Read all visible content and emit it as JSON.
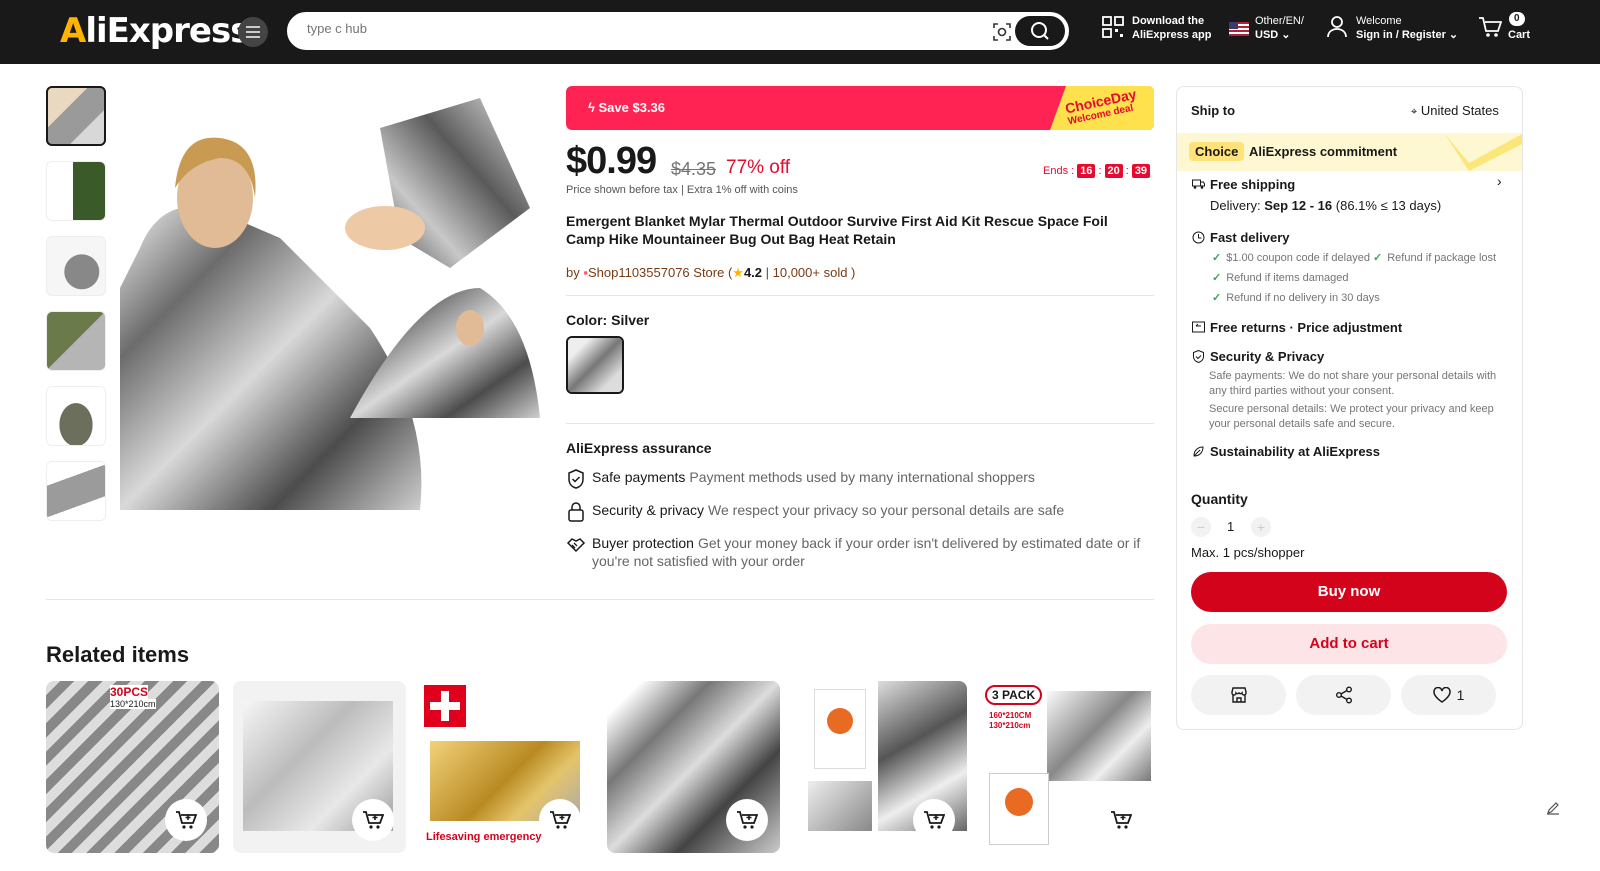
{
  "header": {
    "logo": "AliExpress",
    "search_placeholder": "type c hub",
    "download_line1": "Download the",
    "download_line2": "AliExpress app",
    "locale_line1": "Other/EN/",
    "locale_line2": "USD",
    "welcome": "Welcome",
    "signin": "Sign in / Register",
    "cart_count": "0",
    "cart_label": "Cart"
  },
  "promo": {
    "save": "Save $3.36",
    "choice_day": "ChoiceDay",
    "welcome_deal": "Welcome deal"
  },
  "product": {
    "price": "$0.99",
    "old_price": "$4.35",
    "discount": "77% off",
    "ends_label": "Ends :",
    "ends_h": "16",
    "ends_m": "20",
    "ends_s": "39",
    "tax_note": "Price shown before tax  |  Extra 1% off with coins",
    "title": "Emergent Blanket Mylar Thermal Outdoor Survive First Aid Kit Rescue Space Foil Camp Hike Mountaineer Bug Out Bag Heat Retain",
    "store_prefix": "by",
    "store_name": "Shop1103557076 Store (",
    "rating": "4.2",
    "sold": " | 10,000+ sold )",
    "color_label": "Color: Silver"
  },
  "assurance": {
    "heading": "AliExpress assurance",
    "items": [
      {
        "title": "Safe payments",
        "desc": "Payment methods used by many international shoppers"
      },
      {
        "title": "Security & privacy",
        "desc": "We respect your privacy so your personal details are safe"
      },
      {
        "title": "Buyer protection",
        "desc": "Get your money back if your order isn't delivered by estimated date or if you're not satisfied with your order"
      }
    ]
  },
  "related": {
    "heading": "Related items",
    "badges": [
      "30PCS",
      "130*210cm",
      "Lifesaving emergency",
      "3 PACK",
      "160*210CM",
      "130*210cm"
    ]
  },
  "panel": {
    "ship_to": "Ship to",
    "country": "United States",
    "choice": "Choice",
    "commitment": "AliExpress commitment",
    "free_shipping": "Free shipping",
    "delivery_prefix": "Delivery:",
    "delivery_dates": "Sep 12 - 16",
    "delivery_stat": "(86.1% ≤ 13 days)",
    "fast_delivery": "Fast delivery",
    "fd1": "$1.00 coupon code if delayed",
    "fd2": "Refund if package lost",
    "fd3": "Refund if items damaged",
    "fd4": "Refund if no delivery in 30 days",
    "free_returns": "Free returns · Price adjustment",
    "security": "Security & Privacy",
    "sec1": "Safe payments: We do not share your personal details with any third parties without your consent.",
    "sec2": "Secure personal details: We protect your privacy and keep your personal details safe and secure.",
    "sustain": "Sustainability at AliExpress",
    "quantity": "Quantity",
    "qty_value": "1",
    "max": "Max. 1 pcs/shopper",
    "buy": "Buy now",
    "add_cart": "Add to cart",
    "wish_count": "1"
  },
  "colors": {
    "brand_red": "#d3031c",
    "promo_pink": "#fe2353",
    "choice_yellow": "#ffe04d",
    "dark": "#191919"
  }
}
